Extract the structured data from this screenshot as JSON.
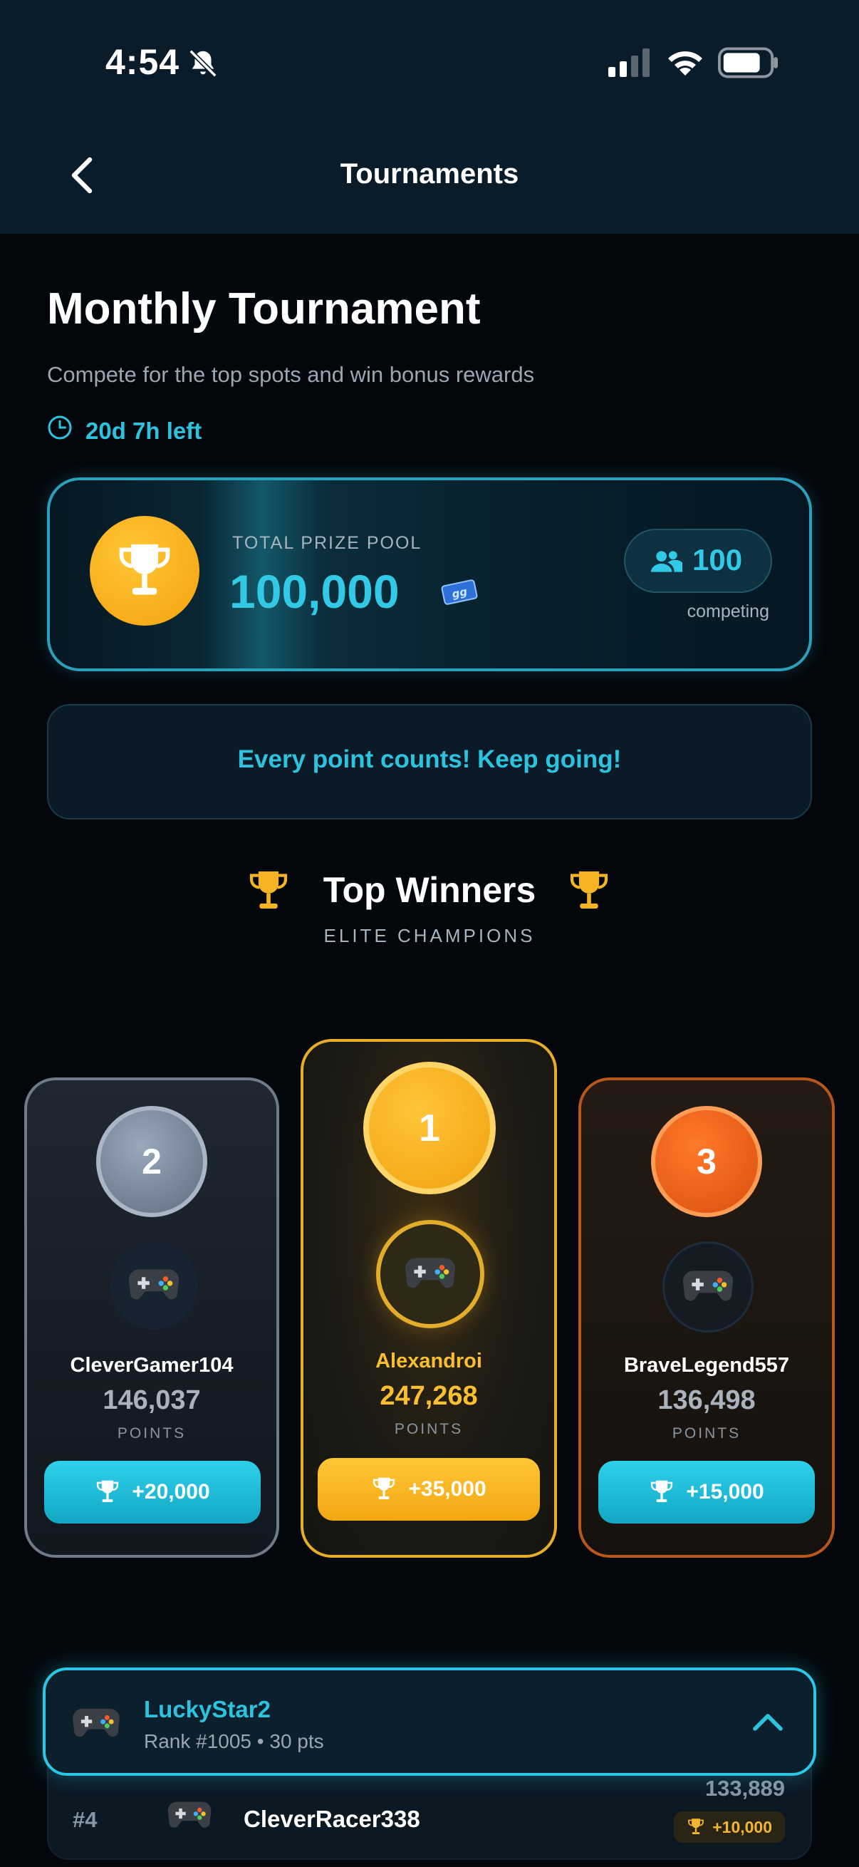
{
  "status_bar": {
    "time": "4:54"
  },
  "nav": {
    "title": "Tournaments"
  },
  "tournament": {
    "title": "Monthly Tournament",
    "subtitle": "Compete for the top spots and win bonus rewards",
    "time_left": "20d 7h left"
  },
  "prize_pool": {
    "label": "TOTAL PRIZE POOL",
    "value": "100,000",
    "token_label": "gg",
    "competing_count": "100",
    "competing_label": "competing"
  },
  "motivation": {
    "text": "Every point counts! Keep going!"
  },
  "top_winners": {
    "title": "Top Winners",
    "subtitle": "ELITE CHAMPIONS",
    "podium": [
      {
        "rank": "2",
        "name": "CleverGamer104",
        "points": "146,037",
        "points_label": "POINTS",
        "reward": "+20,000"
      },
      {
        "rank": "1",
        "name": "Alexandroi",
        "points": "247,268",
        "points_label": "POINTS",
        "reward": "+35,000"
      },
      {
        "rank": "3",
        "name": "BraveLegend557",
        "points": "136,498",
        "points_label": "POINTS",
        "reward": "+15,000"
      }
    ]
  },
  "leaderboard": [
    {
      "rank": "#4",
      "name": "CleverRacer338",
      "points": "133,889",
      "reward": "+10,000"
    }
  ],
  "current_user": {
    "name": "LuckyStar2",
    "rank_line": "Rank #1005 • 30 pts"
  },
  "colors": {
    "accent_cyan": "#2cc3df",
    "gold": "#f9bf2f",
    "silver": "#6f7b89",
    "bronze": "#b9561a",
    "background": "#03070c"
  }
}
